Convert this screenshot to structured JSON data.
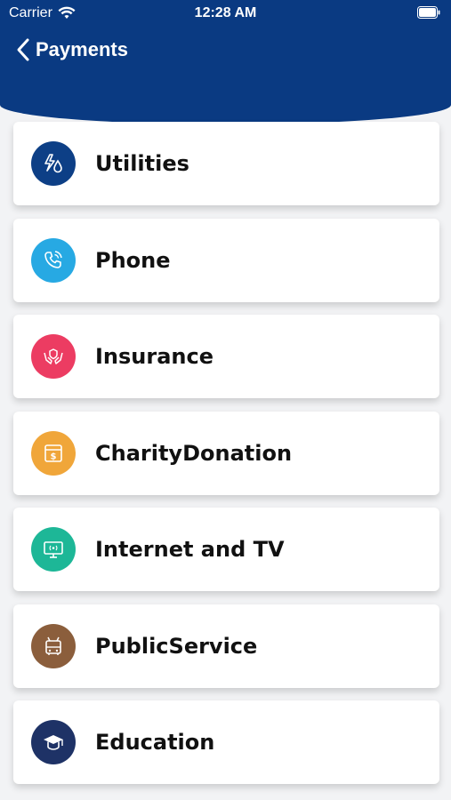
{
  "status_bar": {
    "carrier": "Carrier",
    "time": "12:28 AM"
  },
  "header": {
    "title": "Payments"
  },
  "colors": {
    "header_bg": "#0a3a82"
  },
  "items": [
    {
      "label": "Utilities",
      "icon": "utilities-icon",
      "color": "#0d3f86"
    },
    {
      "label": "Phone",
      "icon": "phone-icon",
      "color": "#27a9e3"
    },
    {
      "label": "Insurance",
      "icon": "insurance-icon",
      "color": "#ec3c62"
    },
    {
      "label": "CharityDonation",
      "icon": "charity-donation-icon",
      "color": "#f0a63a"
    },
    {
      "label": "Internet and TV",
      "icon": "internet-tv-icon",
      "color": "#1db797"
    },
    {
      "label": "PublicService",
      "icon": "public-service-icon",
      "color": "#8b5e3c"
    },
    {
      "label": "Education",
      "icon": "education-icon",
      "color": "#1e3266"
    }
  ]
}
